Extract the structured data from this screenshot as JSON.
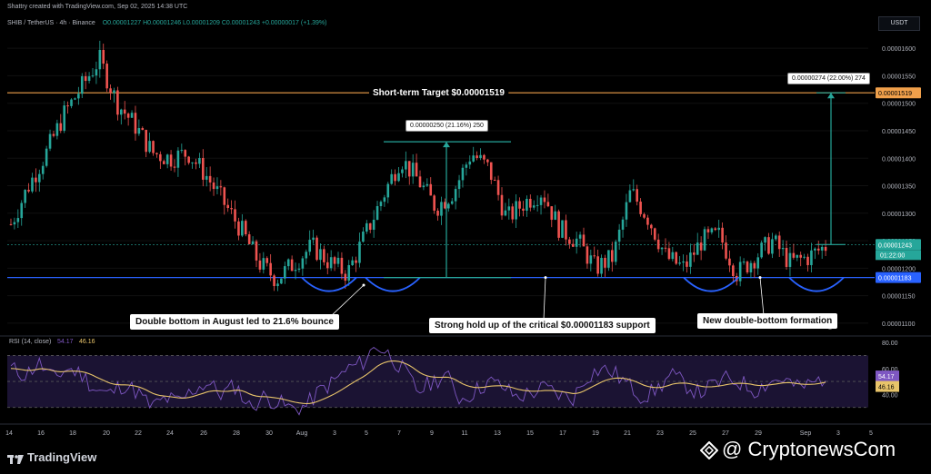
{
  "header": {
    "credit": "Shattry created with TradingView.com, Sep 02, 2025 14:38 UTC",
    "symbol": "SHIB / TetherUS · 4h · Binance",
    "ohlc": "O0.00001227 H0.00001246 L0.00001209 C0.00001243 +0.00000017 (+1.39%)",
    "currency": "USDT"
  },
  "chart_data": {
    "type": "candlestick",
    "title": "SHIB / TetherUS · 4h · Binance",
    "y_ticks": [
      "0.00001600",
      "0.00001550",
      "0.00001500",
      "0.00001450",
      "0.00001400",
      "0.00001350",
      "0.00001300",
      "0.00001250",
      "0.00001200",
      "0.00001150",
      "0.00001100"
    ],
    "ylim": [
      1.08e-05,
      1.63e-05
    ],
    "x_ticks": [
      "14",
      "16",
      "18",
      "20",
      "22",
      "24",
      "26",
      "28",
      "30",
      "Aug",
      "3",
      "5",
      "7",
      "9",
      "11",
      "13",
      "15",
      "17",
      "19",
      "21",
      "23",
      "25",
      "27",
      "29",
      "Sep",
      "3",
      "5"
    ],
    "price_path": [
      1.28e-05,
      1.35e-05,
      1.41e-05,
      1.48e-05,
      1.53e-05,
      1.58e-05,
      1.5e-05,
      1.46e-05,
      1.41e-05,
      1.4e-05,
      1.41e-05,
      1.37e-05,
      1.32e-05,
      1.27e-05,
      1.21e-05,
      1.18e-05,
      1.21e-05,
      1.24e-05,
      1.21e-05,
      1.19e-05,
      1.26e-05,
      1.33e-05,
      1.4e-05,
      1.36e-05,
      1.31e-05,
      1.34e-05,
      1.41e-05,
      1.38e-05,
      1.29e-05,
      1.32e-05,
      1.34e-05,
      1.27e-05,
      1.25e-05,
      1.2e-05,
      1.22e-05,
      1.34e-05,
      1.29e-05,
      1.22e-05,
      1.2e-05,
      1.25e-05,
      1.26e-05,
      1.19e-05,
      1.22e-05,
      1.25e-05,
      1.21e-05,
      1.22e-05,
      1.24e-05
    ],
    "support_line": 1.183e-05,
    "target_line": 1.519e-05,
    "last_price": 1.243e-05,
    "price_labels": {
      "target": "0.00001519",
      "last": "0.00001243",
      "countdown": "01:22:00",
      "support": "0.00001183"
    },
    "annotations": {
      "target_text": "Short-term Target $0.00001519",
      "measure_1": "0.00000250 (21.16%) 250",
      "measure_2": "0.00000274 (22.00%) 274",
      "callout_1": "Double bottom in August led to 21.6% bounce",
      "callout_2": "Strong hold up of the critical $0.00001183 support",
      "callout_3": "New double-bottom formation"
    },
    "rsi": {
      "label": "RSI (14, close)",
      "rsi_value": "54.17",
      "ma_value": "46.16",
      "ticks": [
        "80.00",
        "60.00",
        "40.00"
      ],
      "path": [
        60,
        55,
        64,
        52,
        60,
        56,
        44,
        40,
        48,
        42,
        30,
        37,
        34,
        44,
        49,
        40,
        47,
        30,
        38,
        34,
        29,
        31,
        43,
        50,
        60,
        64,
        78,
        70,
        58,
        42,
        50,
        55,
        36,
        42,
        50,
        46,
        38,
        41,
        45,
        40,
        37,
        54,
        60,
        56,
        47,
        38,
        44,
        55,
        48,
        41,
        47,
        52,
        49,
        43,
        50,
        52,
        45,
        48,
        54
      ]
    },
    "colors": {
      "up": "#26a69a",
      "down": "#ef5350",
      "target_line": "#f0a04b",
      "support_line": "#2962ff",
      "rsi_line": "#7e57c2",
      "rsi_ma": "#e8c46a",
      "measure": "#26a69a"
    }
  },
  "footer": {
    "brand": "TradingView",
    "watermark": "@ CryptonewsCom"
  }
}
